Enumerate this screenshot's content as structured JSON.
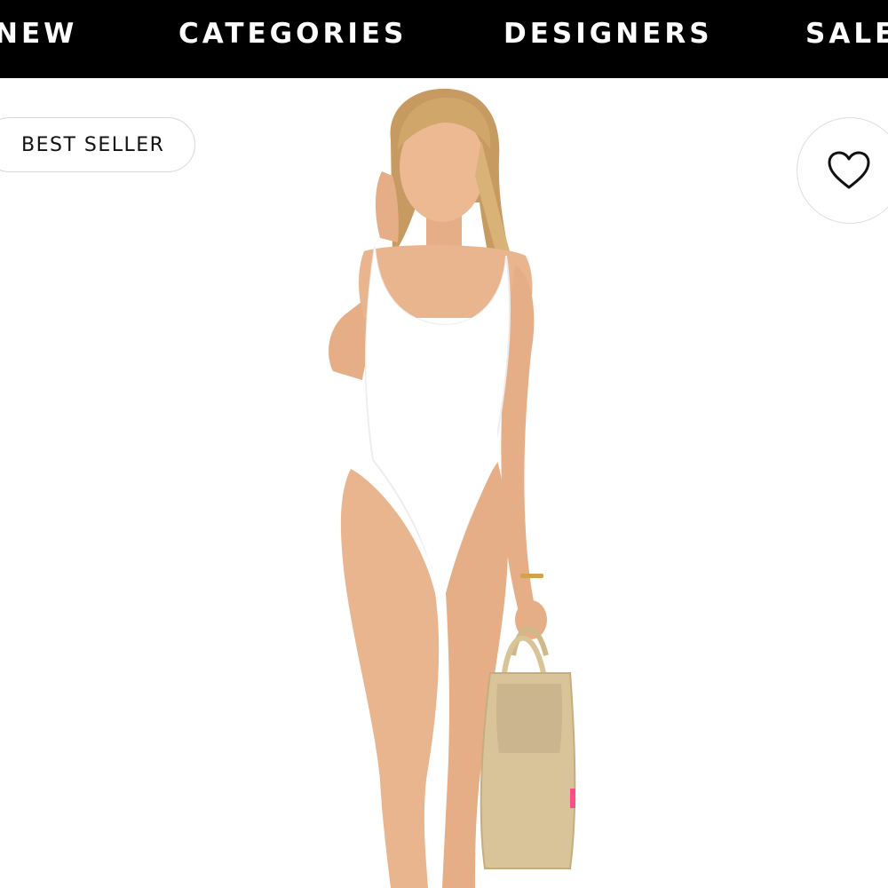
{
  "nav": {
    "items": [
      {
        "label": "NEW"
      },
      {
        "label": "CATEGORIES"
      },
      {
        "label": "DESIGNERS"
      },
      {
        "label": "SALE"
      }
    ]
  },
  "product": {
    "badge": "BEST SELLER",
    "wishlist_icon": "heart-outline-icon"
  },
  "colors": {
    "nav_background": "#000000",
    "nav_text": "#ffffff",
    "page_background": "#ffffff",
    "swimsuit": "#ffffff",
    "skin": "#e9b58e",
    "hair": "#caa06a",
    "tote": "#d9c49a"
  }
}
